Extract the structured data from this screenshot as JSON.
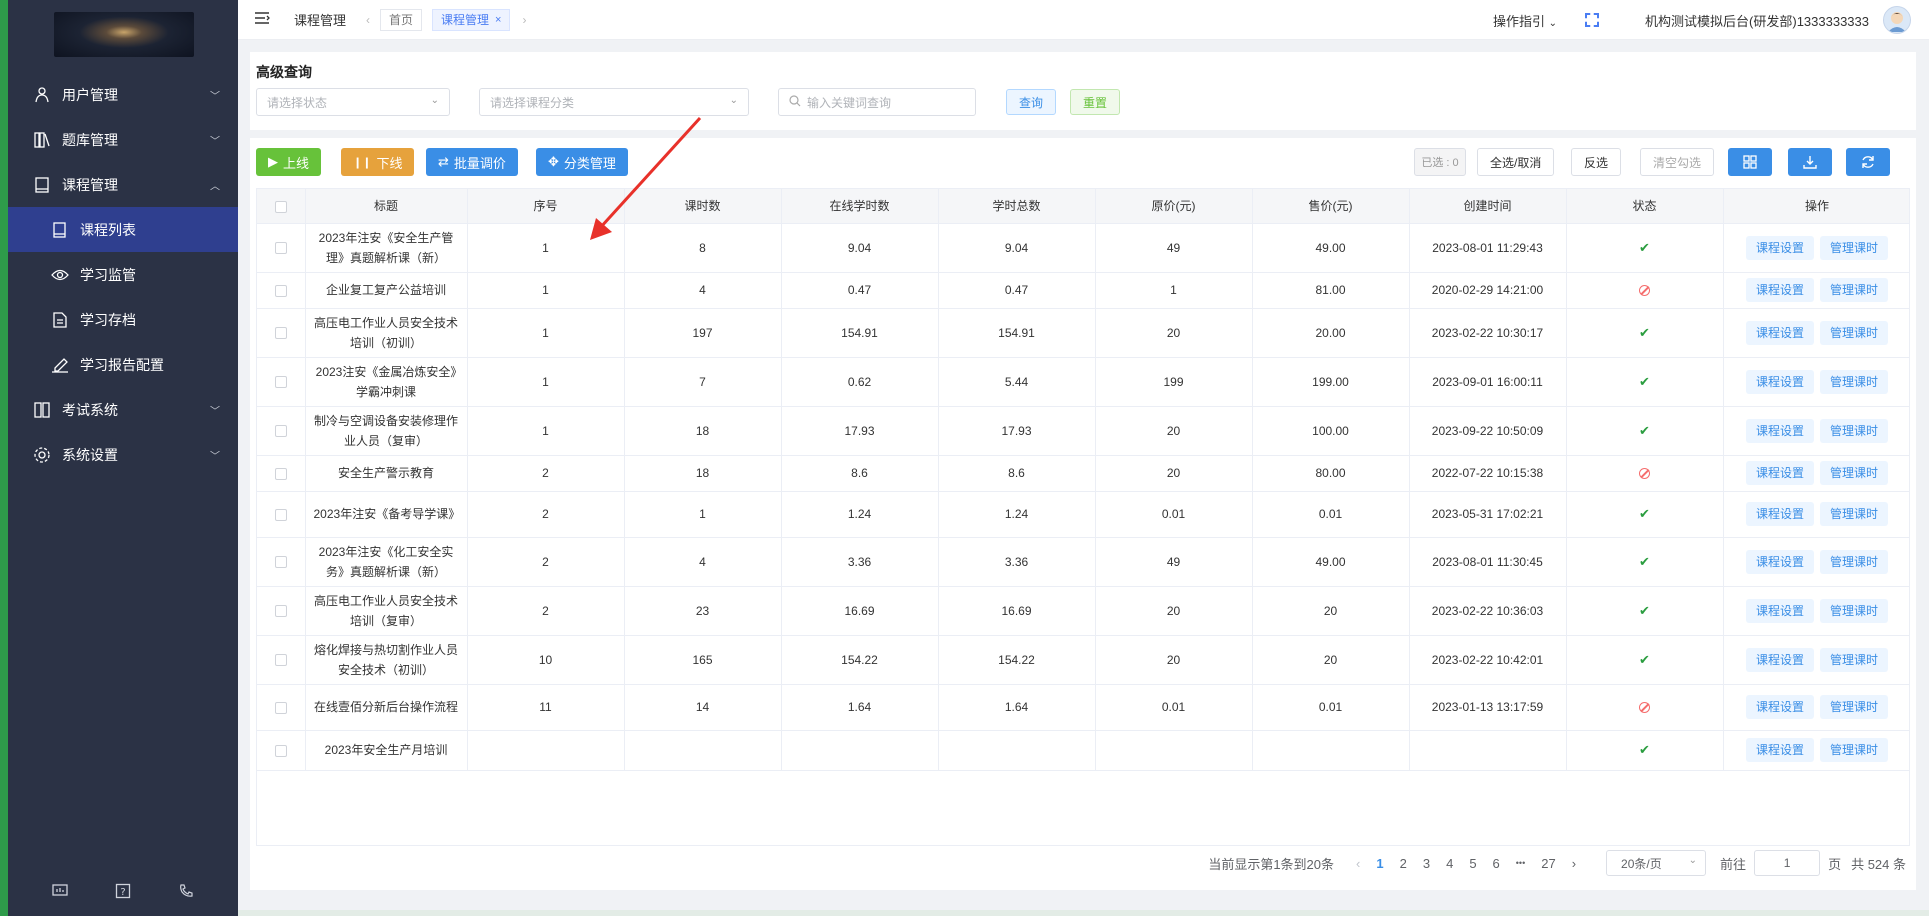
{
  "sidebar": {
    "items": [
      {
        "label": "用户管理",
        "icon": "user-group-icon"
      },
      {
        "label": "题库管理",
        "icon": "book-shelf-icon"
      },
      {
        "label": "课程管理",
        "icon": "book-icon",
        "expanded": true
      },
      {
        "label": "考试系统",
        "icon": "exam-icon"
      },
      {
        "label": "系统设置",
        "icon": "gear-icon"
      }
    ],
    "sub_items": [
      {
        "label": "课程列表",
        "icon": "course-list-icon",
        "active": true
      },
      {
        "label": "学习监管",
        "icon": "eye-icon"
      },
      {
        "label": "学习存档",
        "icon": "document-icon"
      },
      {
        "label": "学习报告配置",
        "icon": "pen-icon"
      }
    ]
  },
  "header": {
    "page_title": "课程管理",
    "tags": [
      "首页",
      "课程管理"
    ],
    "guide": "操作指引",
    "user": "机构测试模拟后台(研发部)1333333333"
  },
  "query": {
    "title": "高级查询",
    "status_placeholder": "请选择状态",
    "category_placeholder": "请选择课程分类",
    "keyword_placeholder": "输入关键词查询",
    "search_label": "查询",
    "reset_label": "重置"
  },
  "toolbar": {
    "online": "上线",
    "offline": "下线",
    "batch_price": "批量调价",
    "category": "分类管理",
    "selected": "已选 : 0",
    "select_all": "全选/取消",
    "invert": "反选",
    "clear": "清空勾选"
  },
  "table": {
    "columns": [
      "标题",
      "序号",
      "课时数",
      "在线学时数",
      "学时总数",
      "原价(元)",
      "售价(元)",
      "创建时间",
      "状态",
      "操作"
    ],
    "op_labels": [
      "课程设置",
      "管理课时"
    ],
    "rows": [
      {
        "title": "2023年注安《安全生产管理》真题解析课（新）",
        "seq": "1",
        "lessons": "8",
        "online": "9.04",
        "total": "9.04",
        "orig": "49",
        "price": "49.00",
        "created": "2023-08-01 11:29:43",
        "status": "ok"
      },
      {
        "title": "企业复工复产公益培训",
        "seq": "1",
        "lessons": "4",
        "online": "0.47",
        "total": "0.47",
        "orig": "1",
        "price": "81.00",
        "created": "2020-02-29 14:21:00",
        "status": "off"
      },
      {
        "title": "高压电工作业人员安全技术培训（初训）",
        "seq": "1",
        "lessons": "197",
        "online": "154.91",
        "total": "154.91",
        "orig": "20",
        "price": "20.00",
        "created": "2023-02-22 10:30:17",
        "status": "ok"
      },
      {
        "title": "2023注安《金属冶炼安全》学霸冲刺课",
        "seq": "1",
        "lessons": "7",
        "online": "0.62",
        "total": "5.44",
        "orig": "199",
        "price": "199.00",
        "created": "2023-09-01 16:00:11",
        "status": "ok"
      },
      {
        "title": "制冷与空调设备安装修理作业人员（复审）",
        "seq": "1",
        "lessons": "18",
        "online": "17.93",
        "total": "17.93",
        "orig": "20",
        "price": "100.00",
        "created": "2023-09-22 10:50:09",
        "status": "ok"
      },
      {
        "title": "安全生产警示教育",
        "seq": "2",
        "lessons": "18",
        "online": "8.6",
        "total": "8.6",
        "orig": "20",
        "price": "80.00",
        "created": "2022-07-22 10:15:38",
        "status": "off"
      },
      {
        "title": "2023年注安《备考导学课》",
        "seq": "2",
        "lessons": "1",
        "online": "1.24",
        "total": "1.24",
        "orig": "0.01",
        "price": "0.01",
        "created": "2023-05-31 17:02:21",
        "status": "ok"
      },
      {
        "title": "2023年注安《化工安全实务》真题解析课（新）",
        "seq": "2",
        "lessons": "4",
        "online": "3.36",
        "total": "3.36",
        "orig": "49",
        "price": "49.00",
        "created": "2023-08-01 11:30:45",
        "status": "ok"
      },
      {
        "title": "高压电工作业人员安全技术培训（复审）",
        "seq": "2",
        "lessons": "23",
        "online": "16.69",
        "total": "16.69",
        "orig": "20",
        "price": "20",
        "created": "2023-02-22 10:36:03",
        "status": "ok"
      },
      {
        "title": "熔化焊接与热切割作业人员安全技术（初训）",
        "seq": "10",
        "lessons": "165",
        "online": "154.22",
        "total": "154.22",
        "orig": "20",
        "price": "20",
        "created": "2023-02-22 10:42:01",
        "status": "ok"
      },
      {
        "title": "在线壹佰分新后台操作流程",
        "seq": "11",
        "lessons": "14",
        "online": "1.64",
        "total": "1.64",
        "orig": "0.01",
        "price": "0.01",
        "created": "2023-01-13 13:17:59",
        "status": "off"
      },
      {
        "title": "2023年安全生产月培训",
        "seq": "",
        "lessons": "",
        "online": "",
        "total": "",
        "orig": "",
        "price": "",
        "created": "",
        "status": "ok"
      }
    ]
  },
  "pagination": {
    "summary": "当前显示第1条到20条",
    "pages": [
      "1",
      "2",
      "3",
      "4",
      "5",
      "6"
    ],
    "ellipsis": "•••",
    "last": "27",
    "page_size": "20条/页",
    "goto_label": "前往",
    "goto_value": "1",
    "page_unit": "页",
    "total": "共 524 条"
  },
  "colors": {
    "sidebar_bg": "#2b3245",
    "active_bg": "#2f3f8f",
    "primary": "#3a8ee6",
    "green": "#67c23a",
    "orange": "#e6a23c",
    "red_arrow": "#e8312a"
  }
}
